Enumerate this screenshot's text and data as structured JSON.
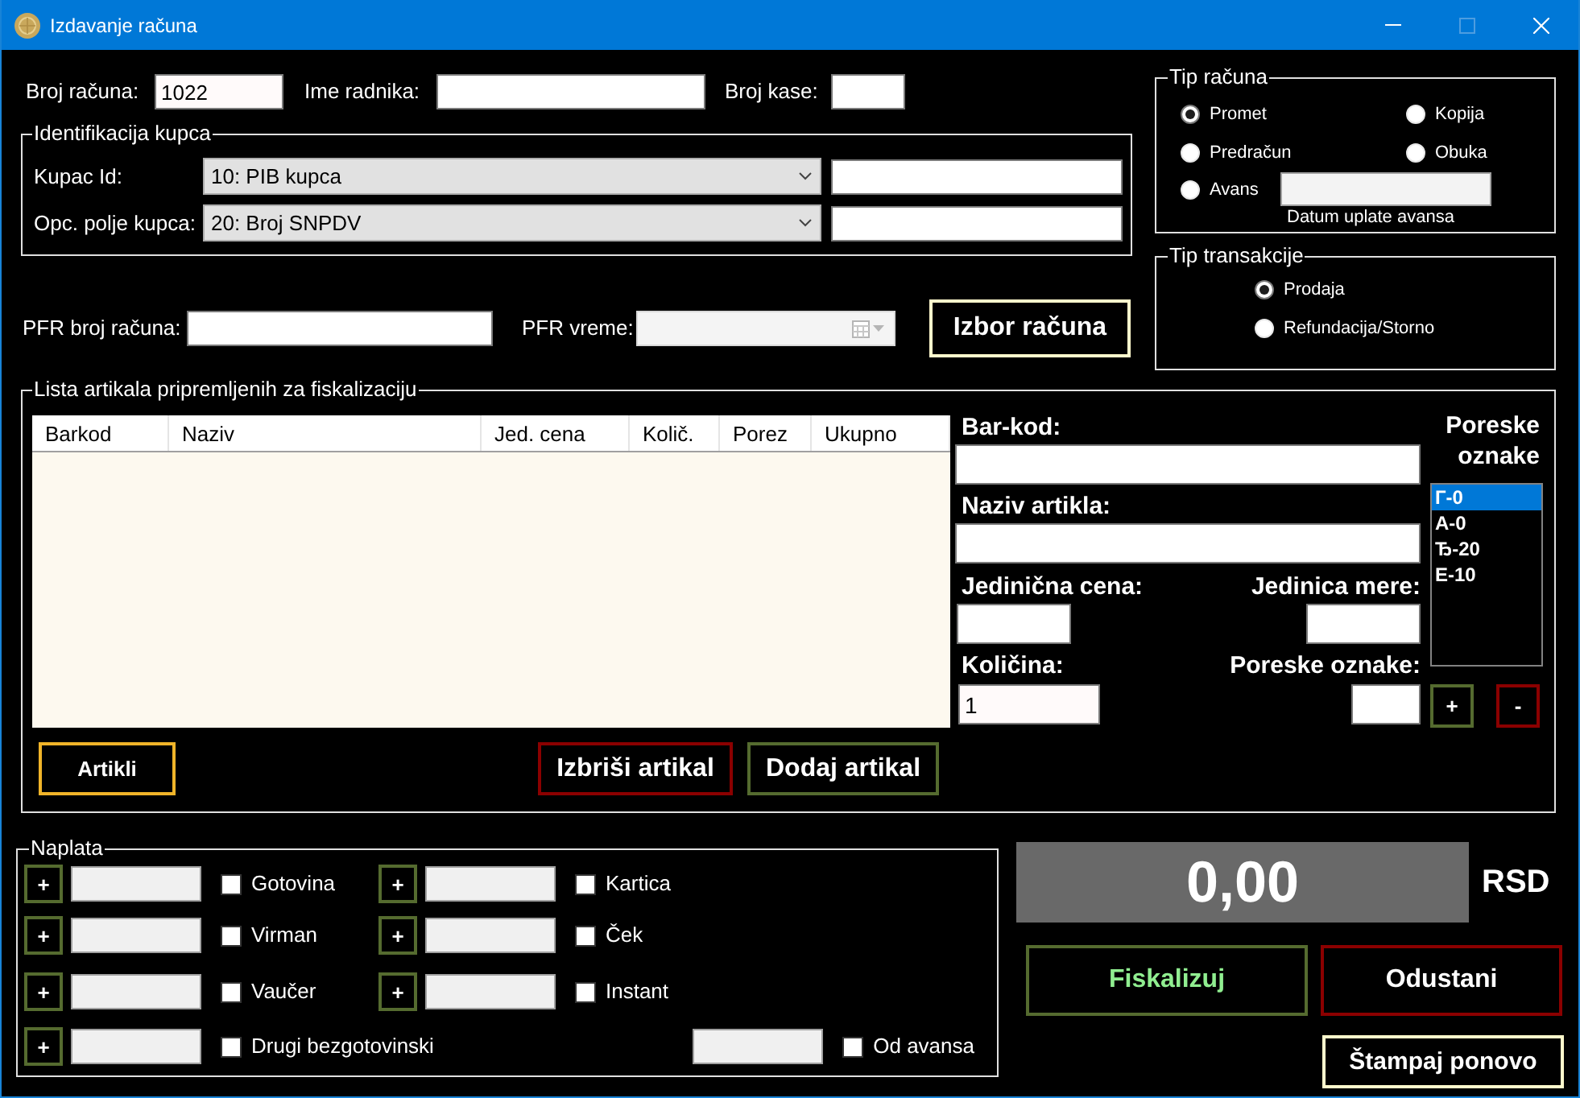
{
  "window": {
    "title": "Izdavanje računa",
    "controls": [
      {
        "kind": "minimize",
        "disabled": false
      },
      {
        "kind": "maximize",
        "disabled": true
      },
      {
        "kind": "close",
        "disabled": false
      }
    ]
  },
  "invoice_fields": [
    {
      "label": "Broj računa:",
      "value": "1022"
    },
    {
      "label": "Ime radnika:"
    },
    {
      "label": "Broj kase:"
    }
  ],
  "customer_identification": {
    "title": "Identifikacija kupca",
    "rows": [
      {
        "label": "Kupac Id:",
        "selected_option": "10: PIB kupca"
      },
      {
        "label": "Opc. polje kupca:",
        "selected_option": "20: Broj SNPDV"
      }
    ]
  },
  "pfr": {
    "number_label": "PFR broj računa:",
    "time_label": "PFR vreme:",
    "time_disabled": true,
    "select_button": "Izbor računa"
  },
  "invoice_type": {
    "title": "Tip računa",
    "options": [
      {
        "label": "Promet",
        "selected": true
      },
      {
        "label": "Kopija",
        "selected": false
      },
      {
        "label": "Predračun",
        "selected": false
      },
      {
        "label": "Obuka",
        "selected": false
      },
      {
        "label": "Avans",
        "selected": false
      }
    ],
    "advance_date": {
      "label": "Datum uplate avansa",
      "disabled": true
    }
  },
  "transaction_type": {
    "title": "Tip transakcije",
    "options": [
      {
        "label": "Prodaja",
        "selected": true
      },
      {
        "label": "Refundacija/Storno",
        "selected": false
      }
    ]
  },
  "article_list": {
    "title": "Lista artikala pripremljenih za fiskalizaciju",
    "table": {
      "columns": [
        "Barkod",
        "Naziv",
        "Jed. cena",
        "Količ.",
        "Porez",
        "Ukupno"
      ]
    },
    "buttons": [
      {
        "label": "Artikli",
        "kind": "accent"
      },
      {
        "label": "Izbriši artikal",
        "kind": "danger"
      },
      {
        "label": "Dodaj artikal",
        "kind": "confirm"
      }
    ]
  },
  "article_form": {
    "barcode_label": "Bar-kod:",
    "name_label": "Naziv artikla:",
    "unit_price_label": "Jedinična cena:",
    "unit_label": "Jedinica mere:",
    "quantity_label": "Količina:",
    "quantity": "1",
    "tax_label_label": "Poreske oznake:"
  },
  "tax_labels": {
    "title": "Poreske oznake",
    "items": [
      {
        "label": "Г-0",
        "selected": true
      },
      {
        "label": "А-0",
        "selected": false
      },
      {
        "label": "Ђ-20",
        "selected": false
      },
      {
        "label": "Е-10",
        "selected": false
      }
    ],
    "buttons": [
      {
        "label": "+",
        "kind": "confirm"
      },
      {
        "label": "-",
        "kind": "danger"
      }
    ]
  },
  "payment": {
    "title": "Naplata",
    "rows": [
      [
        {
          "label": "Gotovina",
          "checked": false,
          "add_button": "+"
        },
        {
          "label": "Kartica",
          "checked": false,
          "add_button": "+"
        }
      ],
      [
        {
          "label": "Virman",
          "checked": false,
          "add_button": "+"
        },
        {
          "label": "Ček",
          "checked": false,
          "add_button": "+"
        }
      ],
      [
        {
          "label": "Vaučer",
          "checked": false,
          "add_button": "+"
        },
        {
          "label": "Instant",
          "checked": false,
          "add_button": "+"
        }
      ],
      [
        {
          "label": "Drugi bezgotovinski",
          "checked": false,
          "add_button": "+"
        },
        {
          "label": "Od avansa",
          "checked": false
        }
      ]
    ]
  },
  "total": {
    "amount": "0,00",
    "currency": "RSD"
  },
  "actions": [
    {
      "label": "Fiskalizuj",
      "kind": "primary"
    },
    {
      "label": "Odustani",
      "kind": "danger"
    },
    {
      "label": "Štampaj ponovo",
      "kind": "plain"
    }
  ]
}
